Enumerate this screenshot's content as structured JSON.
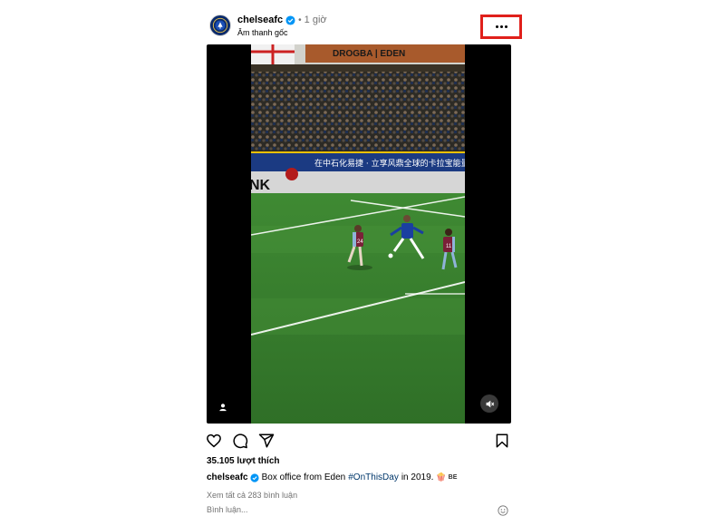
{
  "header": {
    "username": "chelseafc",
    "separator": "•",
    "time": "1 giờ",
    "audio": "Âm thanh gốc"
  },
  "video": {
    "stadium_sign": "DROGBA | EDEN",
    "pitch_banner": "在中石化易捷 · 立享风鼎全球的卡拉宝能量饮",
    "board_fragment": "NK",
    "shirt_numbers": [
      "24",
      "11"
    ]
  },
  "post": {
    "likes": "35.105 lượt thích",
    "caption_user": "chelseafc",
    "caption_text": "Box office from Eden",
    "hashtag": "#OnThisDay",
    "caption_tail": "in 2019.",
    "caption_emoji": "🍿",
    "caption_flag": "BE",
    "view_comments": "Xem tất cả 283 bình luận",
    "comment_placeholder": "Bình luận..."
  },
  "colors": {
    "verified": "#0095f6",
    "highlight": "#e0201b",
    "muted_text": "#737373",
    "hashtag": "#00376b"
  },
  "icons": [
    "heart-icon",
    "comment-icon",
    "share-icon",
    "bookmark-icon",
    "more-icon",
    "mute-icon",
    "user-tag-icon",
    "emoji-icon",
    "verified-icon"
  ]
}
